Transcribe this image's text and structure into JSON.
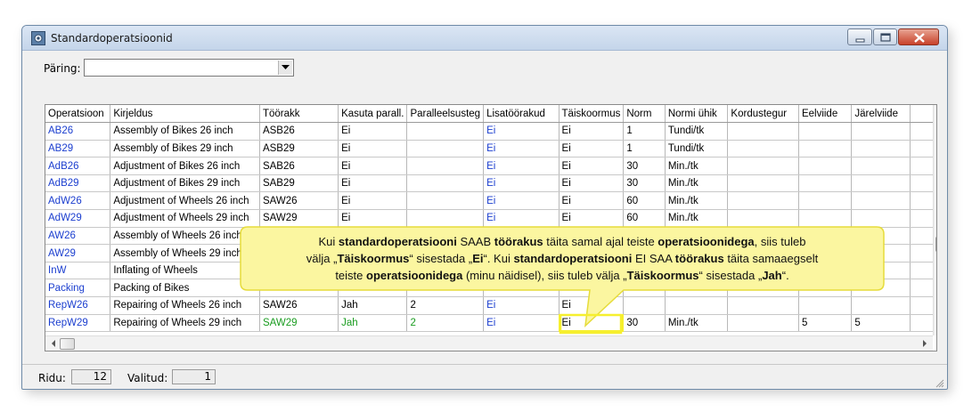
{
  "window": {
    "title": "Standardoperatsioonid"
  },
  "query": {
    "label": "Päring:",
    "value": ""
  },
  "grid": {
    "columns": [
      "Operatsioon",
      "Kirjeldus",
      "Töörakk",
      "Kasuta parall.",
      "Paralleelsusteg",
      "Lisatöörakud",
      "Täiskoormus",
      "Norm",
      "Normi ühik",
      "Kordustegur",
      "Eelviide",
      "Järelviide"
    ],
    "rows": [
      [
        "AB26",
        "Assembly of Bikes 26 inch",
        "ASB26",
        "Ei",
        "",
        "Ei",
        "Ei",
        "1",
        "Tundi/tk",
        "",
        "",
        ""
      ],
      [
        "AB29",
        "Assembly of Bikes 29 inch",
        "ASB29",
        "Ei",
        "",
        "Ei",
        "Ei",
        "1",
        "Tundi/tk",
        "",
        "",
        ""
      ],
      [
        "AdB26",
        "Adjustment of Bikes 26 inch",
        "SAB26",
        "Ei",
        "",
        "Ei",
        "Ei",
        "30",
        "Min./tk",
        "",
        "",
        ""
      ],
      [
        "AdB29",
        "Adjustment of Bikes 29 inch",
        "SAB29",
        "Ei",
        "",
        "Ei",
        "Ei",
        "30",
        "Min./tk",
        "",
        "",
        ""
      ],
      [
        "AdW26",
        "Adjustment of Wheels 26 inch",
        "SAW26",
        "Ei",
        "",
        "Ei",
        "Ei",
        "60",
        "Min./tk",
        "",
        "",
        ""
      ],
      [
        "AdW29",
        "Adjustment of Wheels 29 inch",
        "SAW29",
        "Ei",
        "",
        "Ei",
        "Ei",
        "60",
        "Min./tk",
        "",
        "",
        ""
      ],
      [
        "AW26",
        "Assembly of Wheels 26 inch",
        "",
        "",
        "",
        "",
        "",
        "",
        "",
        "",
        "",
        ""
      ],
      [
        "AW29",
        "Assembly of Wheels 29 inch",
        "",
        "",
        "",
        "",
        "",
        "",
        "",
        "",
        "",
        ""
      ],
      [
        "InW",
        "Inflating of Wheels",
        "",
        "",
        "",
        "",
        "",
        "",
        "",
        "",
        "",
        ""
      ],
      [
        "Packing",
        "Packing of Bikes",
        "",
        "",
        "",
        "",
        "",
        "",
        "",
        "",
        "",
        ""
      ],
      [
        "RepW26",
        "Repairing of Wheels 26 inch",
        "SAW26",
        "Jah",
        "2",
        "Ei",
        "Ei",
        "",
        "",
        "",
        "",
        ""
      ],
      [
        "RepW29",
        "Repairing of Wheels 29 inch",
        "SAW29",
        "Jah",
        "2",
        "Ei",
        "Ei",
        "30",
        "Min./tk",
        "",
        "5",
        "5"
      ]
    ]
  },
  "status": {
    "rows_label": "Ridu:",
    "rows_value": "12",
    "selected_label": "Valitud:",
    "selected_value": "1"
  },
  "callout": {
    "line1": [
      {
        "t": "Kui ",
        "b": false
      },
      {
        "t": "standardoperatsiooni",
        "b": true
      },
      {
        "t": " SAAB ",
        "b": false
      },
      {
        "t": "töörakus",
        "b": true
      },
      {
        "t": " täita samal ajal teiste ",
        "b": false
      },
      {
        "t": "operatsioonidega",
        "b": true
      },
      {
        "t": ", siis tuleb",
        "b": false
      }
    ],
    "line2": [
      {
        "t": "välja „",
        "b": false
      },
      {
        "t": "Täiskoormus",
        "b": true
      },
      {
        "t": "“ sisestada „",
        "b": false
      },
      {
        "t": "Ei",
        "b": true
      },
      {
        "t": "“. Kui ",
        "b": false
      },
      {
        "t": "standardoperatsiooni",
        "b": true
      },
      {
        "t": " EI SAA ",
        "b": false
      },
      {
        "t": "töörakus",
        "b": true
      },
      {
        "t": " täita samaaegselt",
        "b": false
      }
    ],
    "line3": [
      {
        "t": "teiste ",
        "b": false
      },
      {
        "t": "operatsioonidega",
        "b": true
      },
      {
        "t": " (minu näidisel), siis tuleb välja „",
        "b": false
      },
      {
        "t": "Täiskoormus",
        "b": true
      },
      {
        "t": "“ sisestada „",
        "b": false
      },
      {
        "t": "Jah",
        "b": true
      },
      {
        "t": "“.",
        "b": false
      }
    ]
  },
  "colors": {
    "link_blue": "#1b3ecf",
    "green": "#1a9c20",
    "callout_fill": "#fbf6a0",
    "callout_border": "#e6dc3a"
  }
}
